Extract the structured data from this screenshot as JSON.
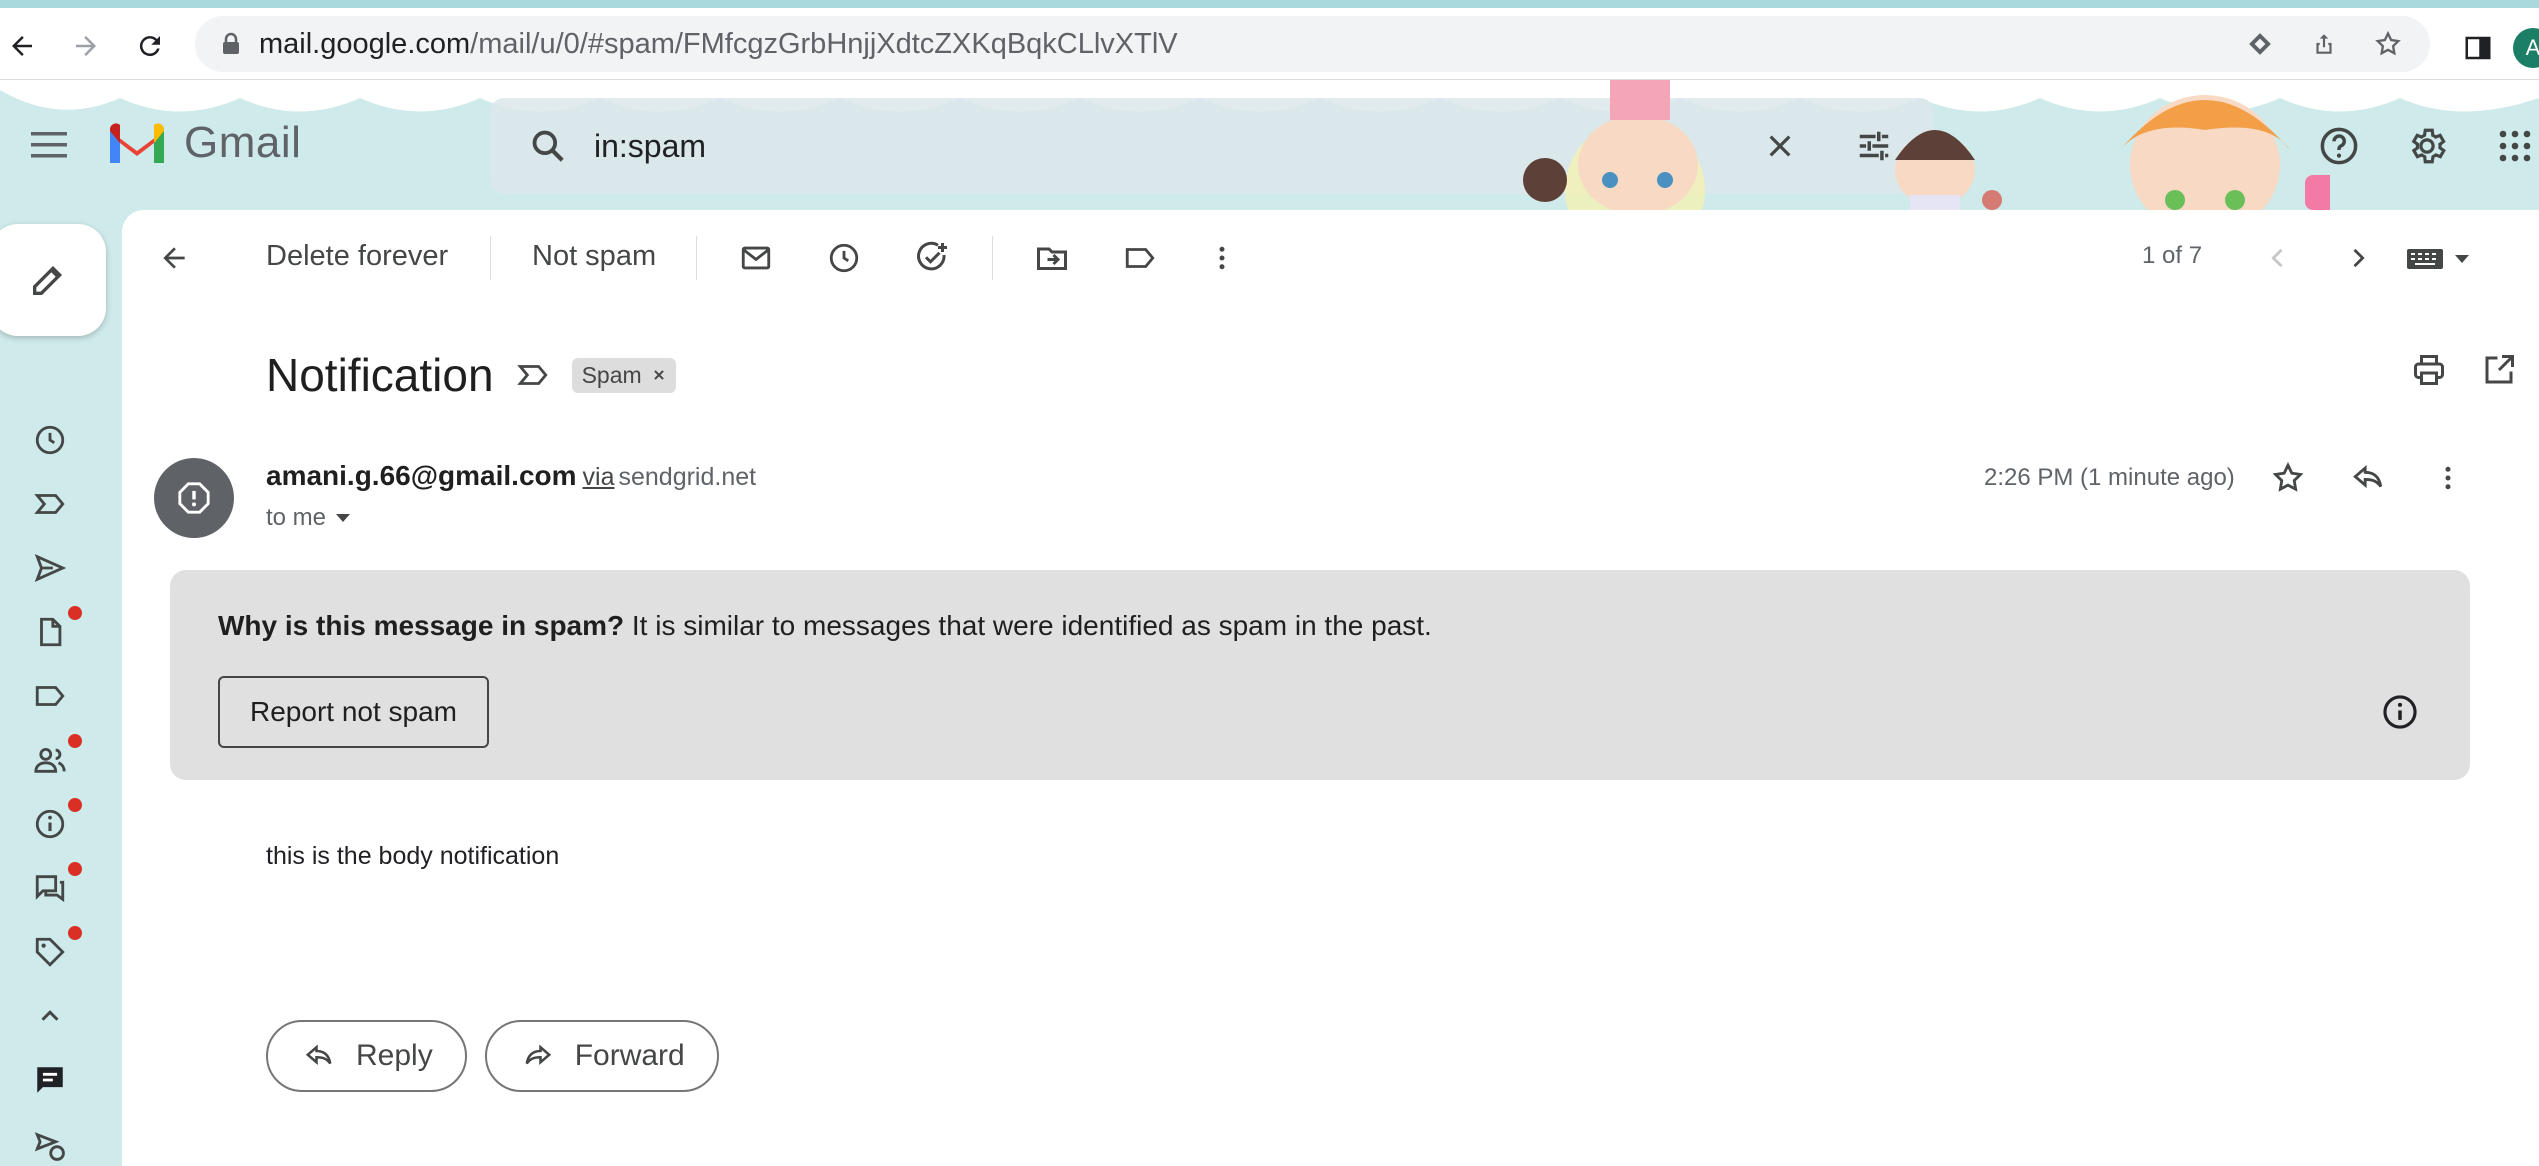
{
  "browser": {
    "url_host": "mail.google.com",
    "url_path": "/mail/u/0/#spam/FMfcgzGrbHnjjXdtcZXKqBqkCLlvXTlV",
    "profile_initial": "A"
  },
  "app": {
    "name": "Gmail"
  },
  "search": {
    "value": "in:spam"
  },
  "toolbar": {
    "delete_forever": "Delete forever",
    "not_spam": "Not spam",
    "pager": "1 of 7"
  },
  "message": {
    "subject": "Notification",
    "label": "Spam",
    "sender_email": "amani.g.66@gmail.com",
    "via": "via",
    "via_host": "sendgrid.net",
    "to": "to me",
    "time": "2:26 PM (1 minute ago)",
    "spam_reason_bold": "Why is this message in spam?",
    "spam_reason": "It is similar to messages that were identified as spam in the past.",
    "report_not_spam": "Report not spam",
    "body": "this is the body notification",
    "reply": "Reply",
    "forward": "Forward"
  },
  "colors": {
    "accent_red": "#d93025",
    "theme_bg": "#cfeaea",
    "spam_box": "#e0e0e0"
  },
  "icons": [
    "back-arrow-icon",
    "forward-arrow-icon",
    "reload-icon",
    "lock-icon",
    "menu-icon",
    "search-icon",
    "clear-icon",
    "tune-icon",
    "help-icon",
    "settings-icon",
    "apps-icon",
    "pencil-icon",
    "clock-icon",
    "important-icon",
    "send-icon",
    "draft-icon",
    "label-icon",
    "people-icon",
    "info-icon",
    "forum-icon",
    "tag-icon",
    "chevron-up-icon",
    "chat-icon",
    "meet-icon",
    "mail-icon",
    "snooze-icon",
    "add-task-icon",
    "move-to-icon",
    "more-vert-icon",
    "keyboard-icon",
    "print-icon",
    "open-new-icon",
    "star-icon",
    "reply-icon"
  ]
}
